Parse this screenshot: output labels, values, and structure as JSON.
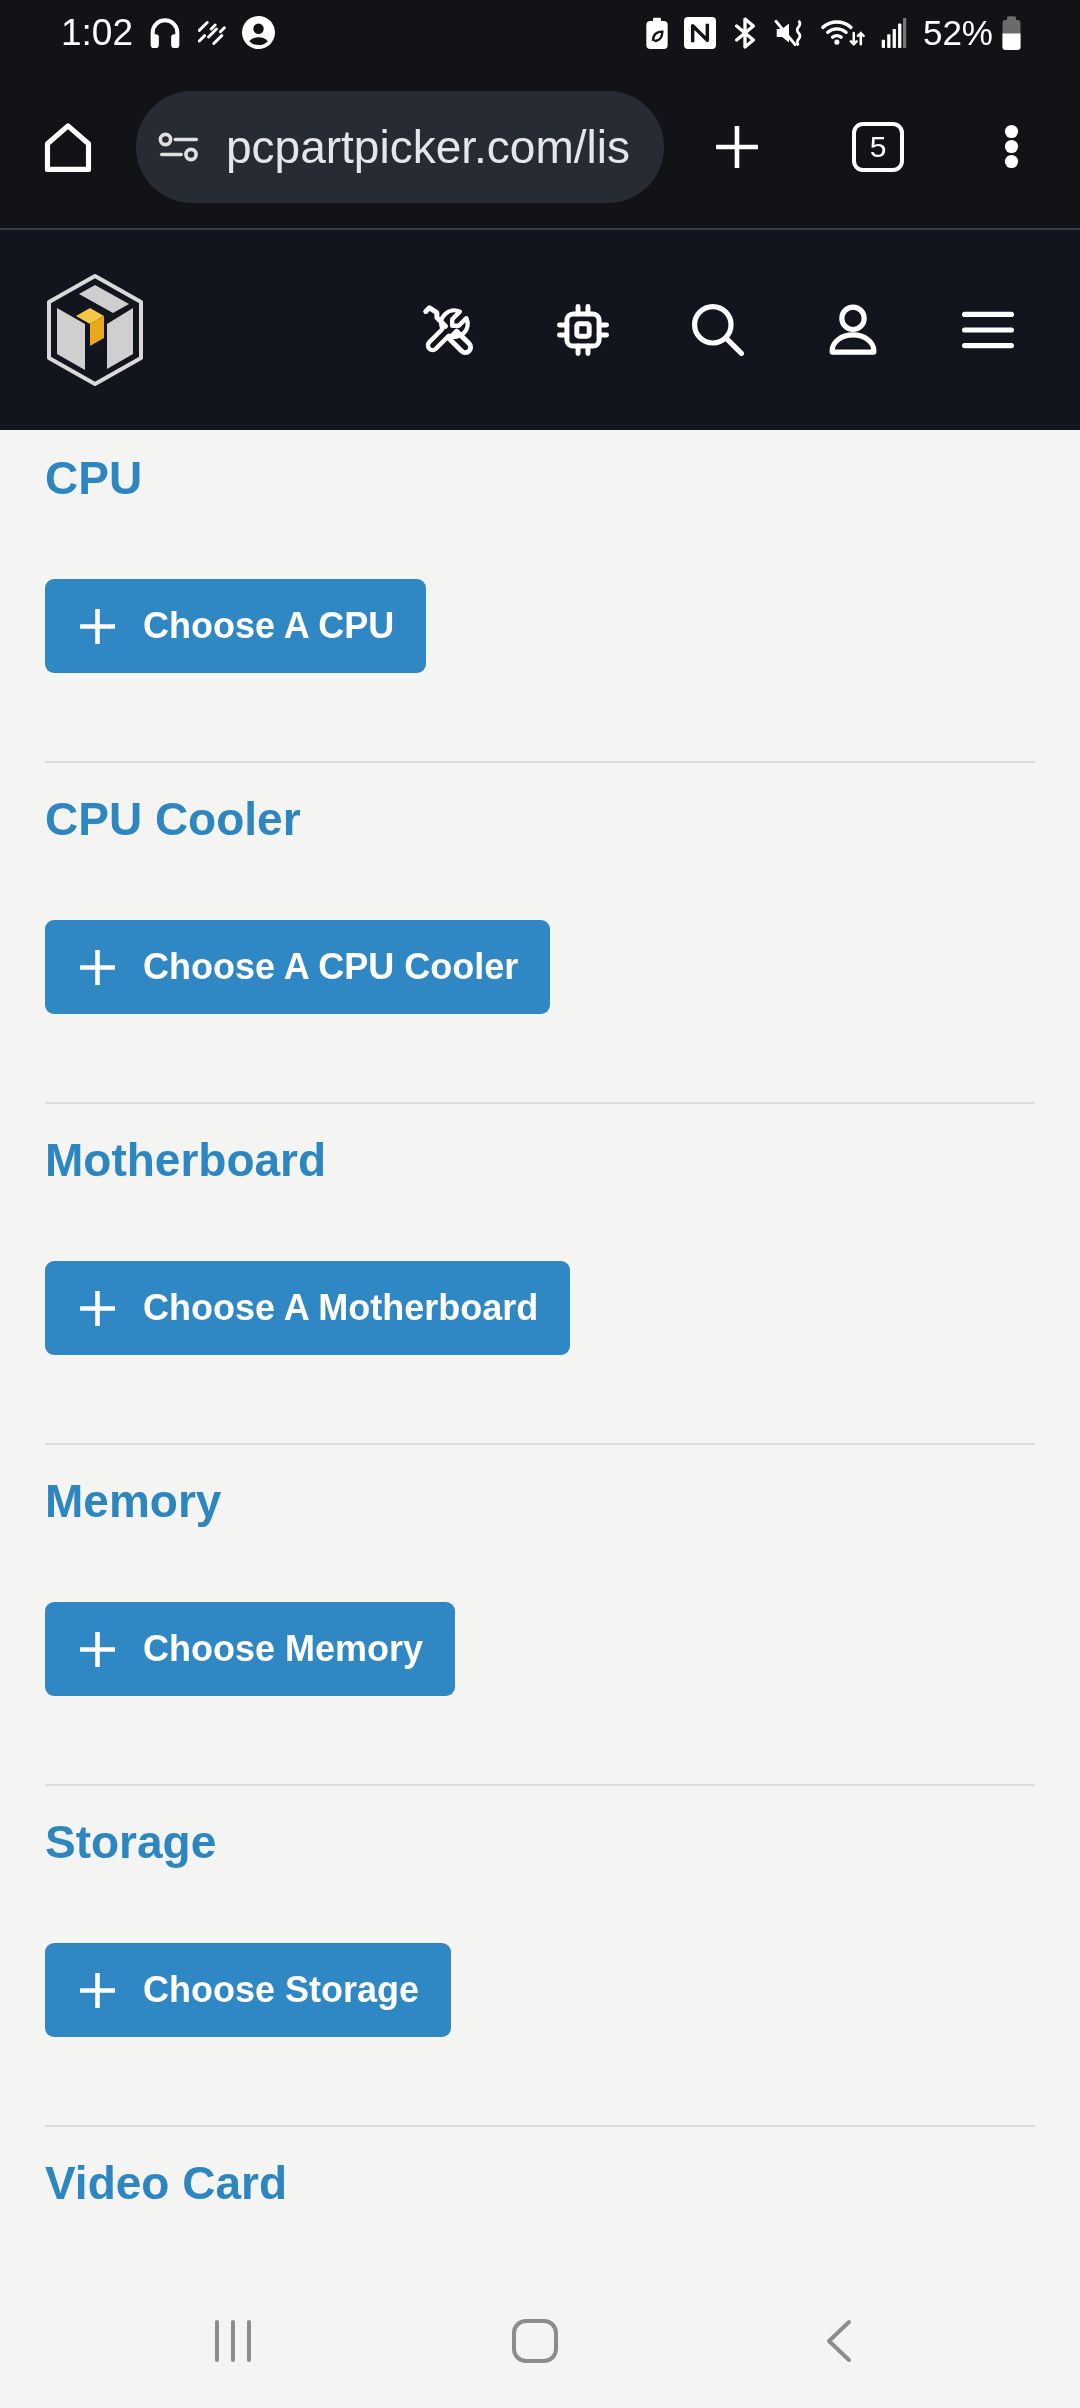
{
  "status_bar": {
    "time": "1:02",
    "battery": "52%"
  },
  "browser": {
    "url": "pcpartpicker.com/lis",
    "tab_count": "5"
  },
  "part_list": [
    {
      "category": "CPU",
      "button": "Choose A CPU"
    },
    {
      "category": "CPU Cooler",
      "button": "Choose A CPU Cooler"
    },
    {
      "category": "Motherboard",
      "button": "Choose A Motherboard"
    },
    {
      "category": "Memory",
      "button": "Choose Memory"
    },
    {
      "category": "Storage",
      "button": "Choose Storage"
    },
    {
      "category": "Video Card"
    }
  ]
}
